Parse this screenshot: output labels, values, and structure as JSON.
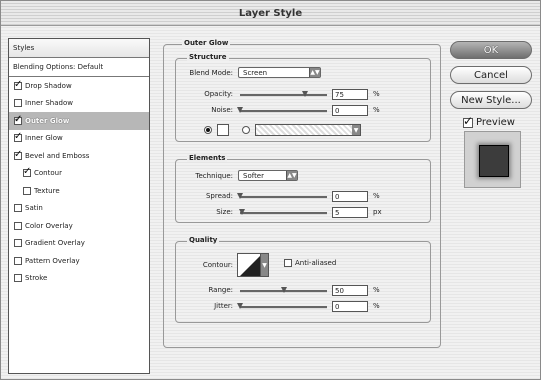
{
  "window": {
    "title": "Layer Style"
  },
  "styles_panel": {
    "header": "Styles",
    "blending": "Blending Options: Default",
    "items": [
      {
        "label": "Drop Shadow",
        "checked": true,
        "indent": false,
        "selected": false
      },
      {
        "label": "Inner Shadow",
        "checked": false,
        "indent": false,
        "selected": false
      },
      {
        "label": "Outer Glow",
        "checked": true,
        "indent": false,
        "selected": true
      },
      {
        "label": "Inner Glow",
        "checked": true,
        "indent": false,
        "selected": false
      },
      {
        "label": "Bevel and Emboss",
        "checked": true,
        "indent": false,
        "selected": false
      },
      {
        "label": "Contour",
        "checked": true,
        "indent": true,
        "selected": false
      },
      {
        "label": "Texture",
        "checked": false,
        "indent": true,
        "selected": false
      },
      {
        "label": "Satin",
        "checked": false,
        "indent": false,
        "selected": false
      },
      {
        "label": "Color Overlay",
        "checked": false,
        "indent": false,
        "selected": false
      },
      {
        "label": "Gradient Overlay",
        "checked": false,
        "indent": false,
        "selected": false
      },
      {
        "label": "Pattern Overlay",
        "checked": false,
        "indent": false,
        "selected": false
      },
      {
        "label": "Stroke",
        "checked": false,
        "indent": false,
        "selected": false
      }
    ]
  },
  "buttons": {
    "ok": "OK",
    "cancel": "Cancel",
    "new_style": "New Style...",
    "preview": "Preview",
    "preview_checked": true
  },
  "outer_glow": {
    "title": "Outer Glow",
    "structure": {
      "title": "Structure",
      "blend_mode_label": "Blend Mode:",
      "blend_mode_value": "Screen",
      "opacity_label": "Opacity:",
      "opacity_value": "75",
      "opacity_unit": "%",
      "opacity_fraction": 0.75,
      "noise_label": "Noise:",
      "noise_value": "0",
      "noise_unit": "%",
      "noise_fraction": 0.0,
      "color_mode": "solid"
    },
    "elements": {
      "title": "Elements",
      "technique_label": "Technique:",
      "technique_value": "Softer",
      "spread_label": "Spread:",
      "spread_value": "0",
      "spread_unit": "%",
      "spread_fraction": 0.0,
      "size_label": "Size:",
      "size_value": "5",
      "size_unit": "px",
      "size_fraction": 0.02
    },
    "quality": {
      "title": "Quality",
      "contour_label": "Contour:",
      "anti_aliased_label": "Anti-aliased",
      "anti_aliased_checked": false,
      "range_label": "Range:",
      "range_value": "50",
      "range_unit": "%",
      "range_fraction": 0.5,
      "jitter_label": "Jitter:",
      "jitter_value": "0",
      "jitter_unit": "%",
      "jitter_fraction": 0.0
    }
  }
}
